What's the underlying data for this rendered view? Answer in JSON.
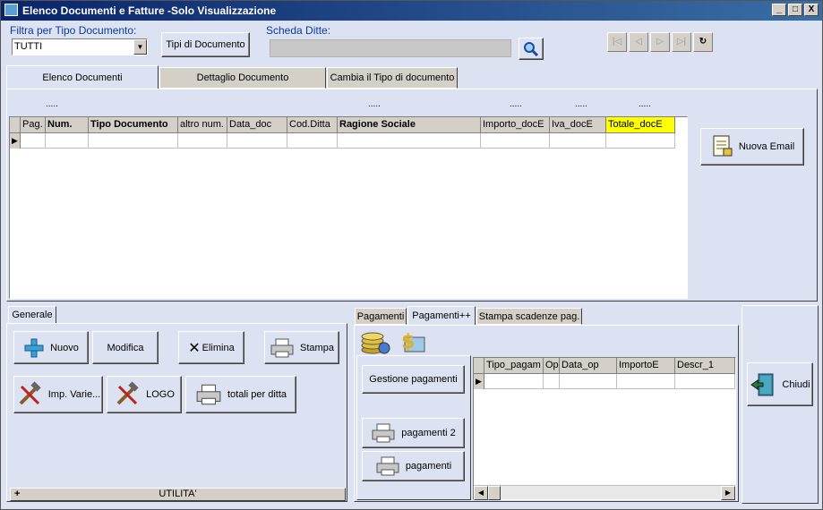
{
  "window": {
    "title": "Elenco Documenti e Fatture -Solo Visualizzazione",
    "controls": [
      "_",
      "□",
      "X"
    ]
  },
  "filter": {
    "label": "Filtra per Tipo Documento:",
    "value": "TUTTI",
    "doc_types_button": "Tipi di Documento"
  },
  "scheda": {
    "label": "Scheda Ditte:"
  },
  "nav": {
    "first": "|◁",
    "prev": "◁",
    "next": "▷",
    "last": "▷|",
    "refresh": "↻"
  },
  "tabs": [
    "Elenco Documenti",
    "Dettaglio Documento",
    "Cambia il Tipo di documento"
  ],
  "dots": [
    ".....",
    ".....",
    ".....",
    ".....",
    "....."
  ],
  "grid": {
    "columns": [
      "Pag.",
      "Num.",
      "Tipo Documento",
      "altro num.",
      "Data_doc",
      "Cod.Ditta",
      "Ragione Sociale",
      "Importo_docE",
      "Iva_docE",
      "Totale_docE"
    ]
  },
  "email_button": "Nuova Email",
  "generale": {
    "tab": "Generale",
    "nuovo": "Nuovo",
    "modifica": "Modifica",
    "elimina": "Elimina",
    "stampa": "Stampa",
    "imp_varie": "Imp. Varie...",
    "logo": "LOGO",
    "totali": "totali per ditta",
    "utilita_plus": "+",
    "utilita": "UTILITA'"
  },
  "pagamenti": {
    "tabs": [
      "Pagamenti",
      "Pagamenti++",
      "Stampa scadenze pag."
    ],
    "gestione": "Gestione pagamenti",
    "pagamenti2": "pagamenti 2",
    "pagamenti": "pagamenti",
    "columns": [
      "Tipo_pagam",
      "Op",
      "Data_op",
      "ImportoE",
      "Descr_1"
    ]
  },
  "chiudi": "Chiudi"
}
